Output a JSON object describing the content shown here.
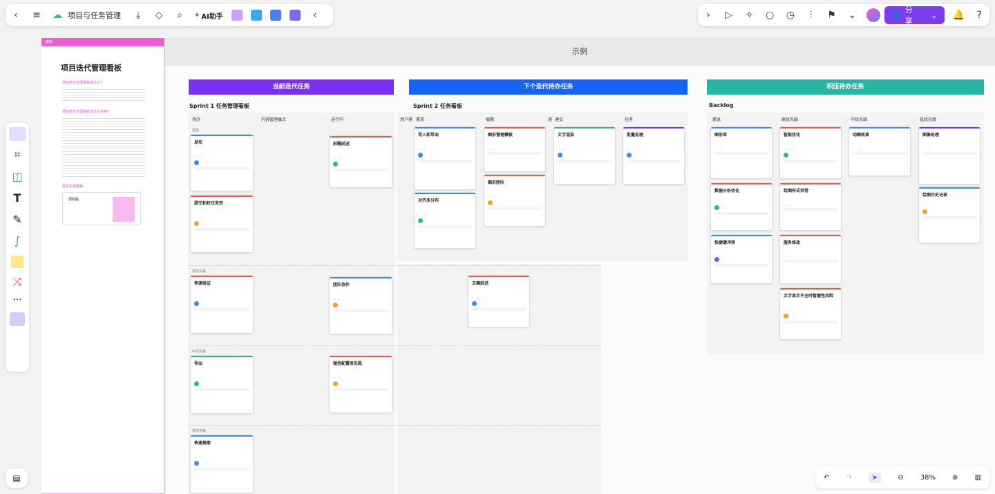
{
  "topbar": {
    "doc_title": "项目与任务管理",
    "ai_label": "AI助手"
  },
  "share": {
    "label": "分享"
  },
  "left_panel": {
    "strip": "模板",
    "title": "项目迭代管理看板",
    "q1": "项目迭代管理看板是什么？",
    "q2": "项目迭代管理看板有什么作用？",
    "more": "更多实用模板",
    "sticky": "便利贴"
  },
  "canvas": {
    "title": "示例"
  },
  "boards": {
    "current": "当前迭代任务",
    "next": "下个迭代待办任务",
    "backlog": "积压待办任务",
    "sprint1": "Sprint 1 任务管理看板",
    "sprint2": "Sprint 2 任务看板",
    "backlog_title": "Backlog"
  },
  "cols1": [
    "待办",
    "内容管理痛点",
    "进行中"
  ],
  "cols2": [
    "用户需",
    "需求",
    "稿期",
    "测",
    "建议",
    "任务"
  ],
  "cols3": [
    "紧急",
    "高优先级",
    "中优先级",
    "低优先级"
  ],
  "lanes": [
    "紧急",
    "高优先级",
    "中优先级",
    "低优先级"
  ],
  "cards": {
    "a1": "发布",
    "a2": "提交和权位失效",
    "a3": "快速验证",
    "a4": "导出",
    "a5": "快速搜索",
    "b1": "前瞻延迟",
    "b2": "团队协作",
    "b3": "微信配置发失败",
    "c1": "导入和导出",
    "c2": "对齐多分布",
    "c3": "图形管理模板",
    "c4": "图形团队",
    "c5": "文字渲染",
    "c6": "批量处理",
    "c7": "文稿延迟",
    "d1": "图形库",
    "d2": "智能优化",
    "d3": "动图效果",
    "d4": "图像处理",
    "d5": "数据分析优化",
    "d6": "绘图样式异常",
    "d7": "快捷键冲突",
    "d8": "服务修改",
    "d9": "绘图历史记录",
    "d10": "文字显示不全时暂缓性风险"
  },
  "zoom": {
    "value": "38%"
  },
  "colors": {
    "purple": "#7b2ff2",
    "blue": "#1663f5",
    "teal": "#27b5a4",
    "accent": "#7b3df0"
  }
}
